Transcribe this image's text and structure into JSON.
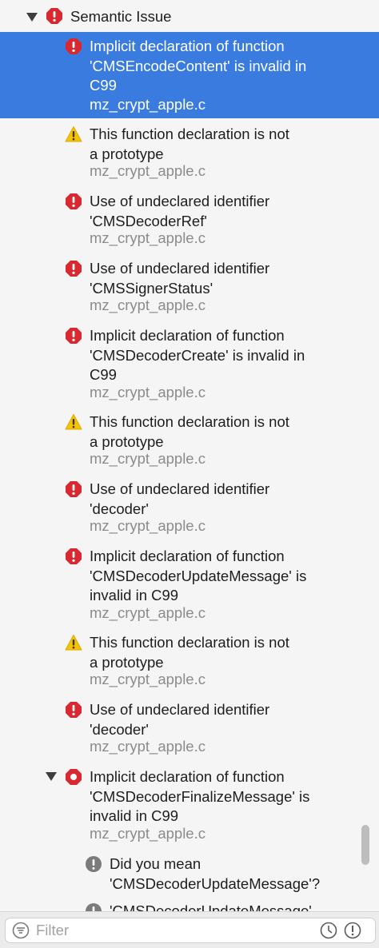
{
  "group": {
    "label": "Semantic Issue",
    "icon": "error-icon",
    "expanded": true
  },
  "issues": [
    {
      "type": "error",
      "icon": "error-icon",
      "message": "Implicit declaration of function\n'CMSEncodeContent' is invalid in\nC99",
      "file": "mz_crypt_apple.c",
      "selected": true
    },
    {
      "type": "warning",
      "icon": "warning-icon",
      "message": "This function declaration is not\na prototype",
      "file": "mz_crypt_apple.c"
    },
    {
      "type": "error",
      "icon": "error-icon",
      "message": "Use of undeclared identifier\n'CMSDecoderRef'",
      "file": "mz_crypt_apple.c"
    },
    {
      "type": "error",
      "icon": "error-icon",
      "message": "Use of undeclared identifier\n'CMSSignerStatus'",
      "file": "mz_crypt_apple.c"
    },
    {
      "type": "error",
      "icon": "error-icon",
      "message": "Implicit declaration of function\n'CMSDecoderCreate' is invalid in\nC99",
      "file": "mz_crypt_apple.c"
    },
    {
      "type": "warning",
      "icon": "warning-icon",
      "message": "This function declaration is not\na prototype",
      "file": "mz_crypt_apple.c"
    },
    {
      "type": "error",
      "icon": "error-icon",
      "message": "Use of undeclared identifier\n'decoder'",
      "file": "mz_crypt_apple.c"
    },
    {
      "type": "error",
      "icon": "error-icon",
      "message": "Implicit declaration of function\n'CMSDecoderUpdateMessage' is\ninvalid in C99",
      "file": "mz_crypt_apple.c"
    },
    {
      "type": "warning",
      "icon": "warning-icon",
      "message": "This function declaration is not\na prototype",
      "file": "mz_crypt_apple.c"
    },
    {
      "type": "error",
      "icon": "error-icon",
      "message": "Use of undeclared identifier\n'decoder'",
      "file": "mz_crypt_apple.c"
    },
    {
      "type": "error-expanded",
      "icon": "error-icon",
      "message": "Implicit declaration of function\n'CMSDecoderFinalizeMessage' is\ninvalid in C99",
      "file": "mz_crypt_apple.c"
    }
  ],
  "notes": [
    {
      "icon": "note-icon",
      "message": "Did you mean\n'CMSDecoderUpdateMessage'?"
    },
    {
      "icon": "note-icon",
      "message": "'CMSDecoderUpdateMessage'"
    }
  ],
  "filter": {
    "placeholder": "Filter",
    "value": ""
  },
  "colors": {
    "selection": "#3a7be0",
    "error": "#d9282f",
    "warning": "#f5c400",
    "note": "#7b7b7b"
  }
}
